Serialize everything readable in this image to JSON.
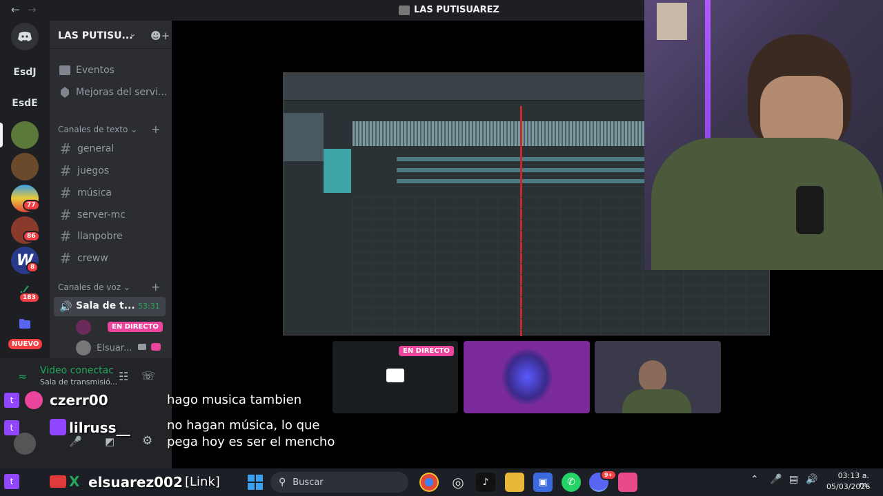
{
  "window": {
    "title": "LAS PUTISUAREZ",
    "back_icon": "arrow-left-icon",
    "forward_icon": "arrow-right-icon"
  },
  "servers": [
    {
      "label": "EsdJ"
    },
    {
      "label": "EsdE"
    },
    {
      "badge": "77"
    },
    {
      "badge": "86"
    },
    {
      "badge": "8"
    },
    {
      "badge": "183"
    },
    {
      "label": "NUEVO"
    }
  ],
  "sidebar": {
    "server_name": "LAS PUTISU...",
    "events": "Eventos",
    "boosts": "Mejoras del servi...",
    "text_category": "Canales de texto",
    "text_channels": [
      "general",
      "juegos",
      "música",
      "server-mc",
      "llanpobre",
      "creww"
    ],
    "voice_category": "Canales de voz",
    "voice_channel": {
      "name": "Sala de t...",
      "timer": "53:31"
    },
    "voice_users": [
      {
        "name": "",
        "status": "EN DIRECTO"
      },
      {
        "name": "Elsuar..."
      }
    ]
  },
  "voice_panel": {
    "status": "Video conectac",
    "subtitle": "Sala de transmisió..."
  },
  "stage": {
    "live_label": "EN DIRECTO"
  },
  "chat": [
    {
      "user": "czerr00",
      "badge_icon": "twitch-icon",
      "message": "hago musica tambien"
    },
    {
      "user": "lilruss__",
      "badge_icon": "twitch-icon",
      "message": "no hagan música, lo que pega hoy es ser el mencho"
    },
    {
      "user": "elsuarez002",
      "suffix": "[Link]",
      "badge_icon": "twitch-icon"
    }
  ],
  "taskbar": {
    "search_placeholder": "Buscar",
    "time": "03:13 a. m.",
    "date": "05/03/2026",
    "discord_badge": "9+"
  },
  "colors": {
    "discord_green": "#23a55a",
    "live_pink": "#eb459e",
    "badge_red": "#f23f43",
    "blurple": "#5865f2"
  }
}
